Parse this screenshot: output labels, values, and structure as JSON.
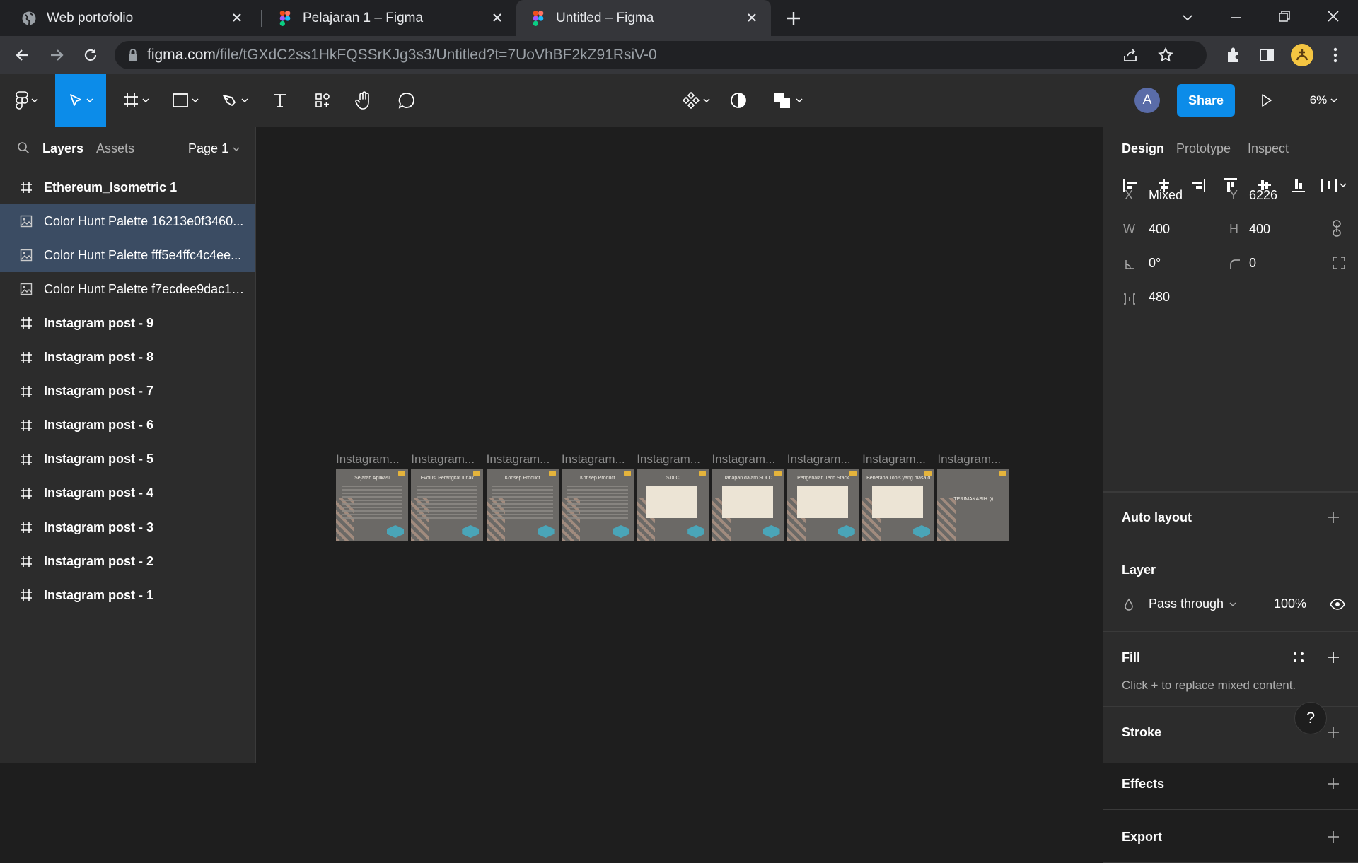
{
  "browser": {
    "tabs": [
      {
        "title": "Web portofolio",
        "icon": "globe-icon"
      },
      {
        "title": "Pelajaran 1 – Figma",
        "icon": "figma-icon"
      },
      {
        "title": "Untitled – Figma",
        "icon": "figma-icon"
      }
    ],
    "url_host": "figma.com",
    "url_path": "/file/tGXdC2ss1HkFQSSrKJg3s3/Untitled?t=7UoVhBF2kZ91RsiV-0"
  },
  "toolbar": {
    "share_label": "Share",
    "zoom": "6%",
    "avatar_initial": "A",
    "accent": "#0c8ce9"
  },
  "left_panel": {
    "tabs": {
      "layers": "Layers",
      "assets": "Assets"
    },
    "page": "Page 1",
    "layers": [
      {
        "name": "Ethereum_Isometric 1",
        "kind": "frame",
        "selected": false
      },
      {
        "name": "Color Hunt Palette 16213e0f3460...",
        "kind": "image",
        "selected": true
      },
      {
        "name": "Color Hunt Palette fff5e4ffc4c4ee...",
        "kind": "image",
        "selected": true
      },
      {
        "name": "Color Hunt Palette f7ecdee9dac19...",
        "kind": "image",
        "selected": false
      },
      {
        "name": "Instagram post - 9",
        "kind": "frame",
        "selected": false
      },
      {
        "name": "Instagram post - 8",
        "kind": "frame",
        "selected": false
      },
      {
        "name": "Instagram post - 7",
        "kind": "frame",
        "selected": false
      },
      {
        "name": "Instagram post - 6",
        "kind": "frame",
        "selected": false
      },
      {
        "name": "Instagram post - 5",
        "kind": "frame",
        "selected": false
      },
      {
        "name": "Instagram post - 4",
        "kind": "frame",
        "selected": false
      },
      {
        "name": "Instagram post - 3",
        "kind": "frame",
        "selected": false
      },
      {
        "name": "Instagram post - 2",
        "kind": "frame",
        "selected": false
      },
      {
        "name": "Instagram post - 1",
        "kind": "frame",
        "selected": false
      }
    ]
  },
  "canvas": {
    "frames": [
      {
        "label": "Instagram...",
        "title": "Sejarah Aplikasi",
        "style": "lines"
      },
      {
        "label": "Instagram...",
        "title": "Evolusi Perangkat lunak",
        "style": "lines"
      },
      {
        "label": "Instagram...",
        "title": "Konsep Product",
        "style": "lines"
      },
      {
        "label": "Instagram...",
        "title": "Konsep Product",
        "style": "lines"
      },
      {
        "label": "Instagram...",
        "title": "SDLC",
        "style": "card"
      },
      {
        "label": "Instagram...",
        "title": "Tahapan dalam SDLC",
        "style": "card"
      },
      {
        "label": "Instagram...",
        "title": "Pengenalan Tech Stack",
        "style": "card"
      },
      {
        "label": "Instagram...",
        "title": "Beberapa Tools yang biasa digunakan seorang PM",
        "style": "card"
      },
      {
        "label": "Instagram...",
        "title": "TERIMAKASIH :))",
        "style": "plain"
      }
    ]
  },
  "right_panel": {
    "tabs": {
      "design": "Design",
      "prototype": "Prototype",
      "inspect": "Inspect"
    },
    "x_label": "X",
    "x_value": "Mixed",
    "y_label": "Y",
    "y_value": "6226",
    "w_label": "W",
    "w_value": "400",
    "h_label": "H",
    "h_value": "400",
    "rotation": "0°",
    "radius": "0",
    "spacing": "480",
    "auto_layout": "Auto layout",
    "layer_title": "Layer",
    "blend_mode": "Pass through",
    "opacity": "100%",
    "fill_title": "Fill",
    "fill_hint": "Click + to replace mixed content.",
    "stroke_title": "Stroke",
    "effects_title": "Effects",
    "export_title": "Export",
    "help": "?"
  }
}
